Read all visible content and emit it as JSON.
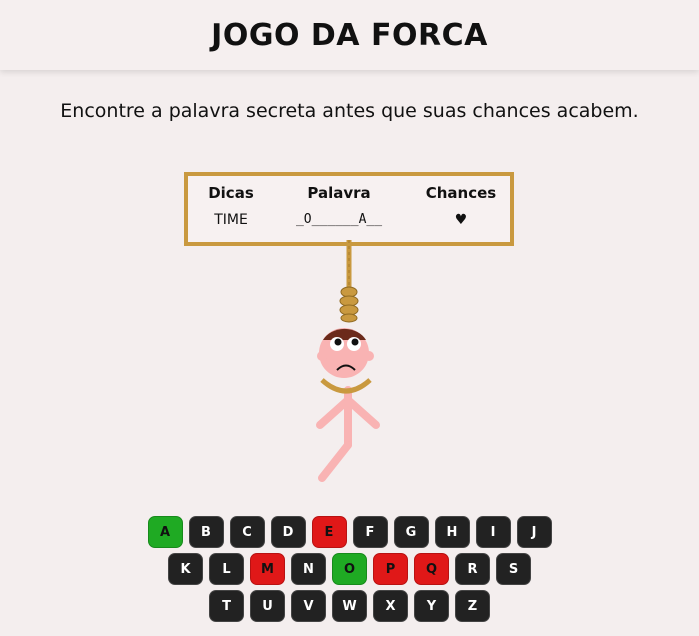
{
  "header": {
    "title": "JOGO DA FORCA"
  },
  "instructions": "Encontre a palavra secreta antes que suas chances acabem.",
  "board": {
    "hint_label": "Dicas",
    "word_label": "Palavra",
    "chances_label": "Chances",
    "hint": "TIME",
    "word": "_O______A__",
    "chances_icon": "heart-icon",
    "chances_symbol": "♥",
    "chances_remaining": 1
  },
  "colors": {
    "correct": "#1faa23",
    "wrong": "#e01818",
    "unused": "#222222",
    "board_border": "#c9993f",
    "heart": "#b30000"
  },
  "keyboard": {
    "rows": [
      [
        {
          "letter": "A",
          "state": "correct"
        },
        {
          "letter": "B",
          "state": "unused"
        },
        {
          "letter": "C",
          "state": "unused"
        },
        {
          "letter": "D",
          "state": "unused"
        },
        {
          "letter": "E",
          "state": "wrong"
        },
        {
          "letter": "F",
          "state": "unused"
        },
        {
          "letter": "G",
          "state": "unused"
        },
        {
          "letter": "H",
          "state": "unused"
        },
        {
          "letter": "I",
          "state": "unused"
        },
        {
          "letter": "J",
          "state": "unused"
        }
      ],
      [
        {
          "letter": "K",
          "state": "unused"
        },
        {
          "letter": "L",
          "state": "unused"
        },
        {
          "letter": "M",
          "state": "wrong"
        },
        {
          "letter": "N",
          "state": "unused"
        },
        {
          "letter": "O",
          "state": "correct"
        },
        {
          "letter": "P",
          "state": "wrong"
        },
        {
          "letter": "Q",
          "state": "wrong"
        },
        {
          "letter": "R",
          "state": "unused"
        },
        {
          "letter": "S",
          "state": "unused"
        }
      ],
      [
        {
          "letter": "T",
          "state": "unused"
        },
        {
          "letter": "U",
          "state": "unused"
        },
        {
          "letter": "V",
          "state": "unused"
        },
        {
          "letter": "W",
          "state": "unused"
        },
        {
          "letter": "X",
          "state": "unused"
        },
        {
          "letter": "Y",
          "state": "unused"
        },
        {
          "letter": "Z",
          "state": "unused"
        }
      ]
    ]
  }
}
